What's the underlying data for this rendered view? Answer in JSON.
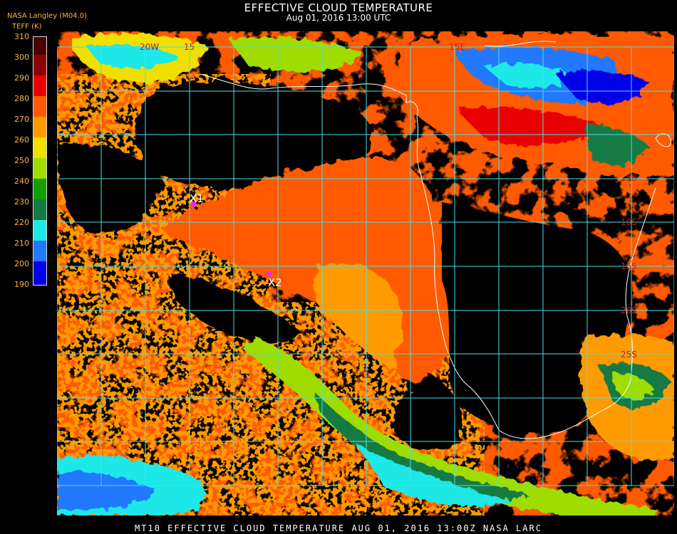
{
  "header": {
    "title": "EFFECTIVE CLOUD TEMPERATURE",
    "subtitle": "Aug 01, 2016 13:00 UTC",
    "source": "NASA Langley (M04.0)",
    "units": "TEFF (K)"
  },
  "colorbar": {
    "labels": [
      "310",
      "300",
      "290",
      "280",
      "270",
      "260",
      "250",
      "240",
      "230",
      "220",
      "210",
      "200",
      "190"
    ],
    "colors": [
      "#4a0000",
      "#8f0000",
      "#e80000",
      "#ff5a00",
      "#ff9a00",
      "#f0e000",
      "#9fdc00",
      "#12a000",
      "#157a44",
      "#1fe8e8",
      "#2278ff",
      "#0000e8",
      "#9a36e8"
    ]
  },
  "map": {
    "lat_labels": [
      "5S",
      "10S",
      "15S",
      "20S",
      "25S"
    ],
    "top_labels": [
      "20W",
      "15",
      "15E"
    ],
    "markers": [
      {
        "label": "X1",
        "color": "#e62ee6"
      },
      {
        "label": "X2",
        "color": "#e62ee6"
      }
    ],
    "grid_color": "#48e0e6",
    "coast_color": "#ffffff",
    "label_color": "#c81e1e"
  },
  "footer": {
    "text": "MT10  EFFECTIVE CLOUD TEMPERATURE   AUG 01, 2016 13:00Z   NASA LARC"
  }
}
